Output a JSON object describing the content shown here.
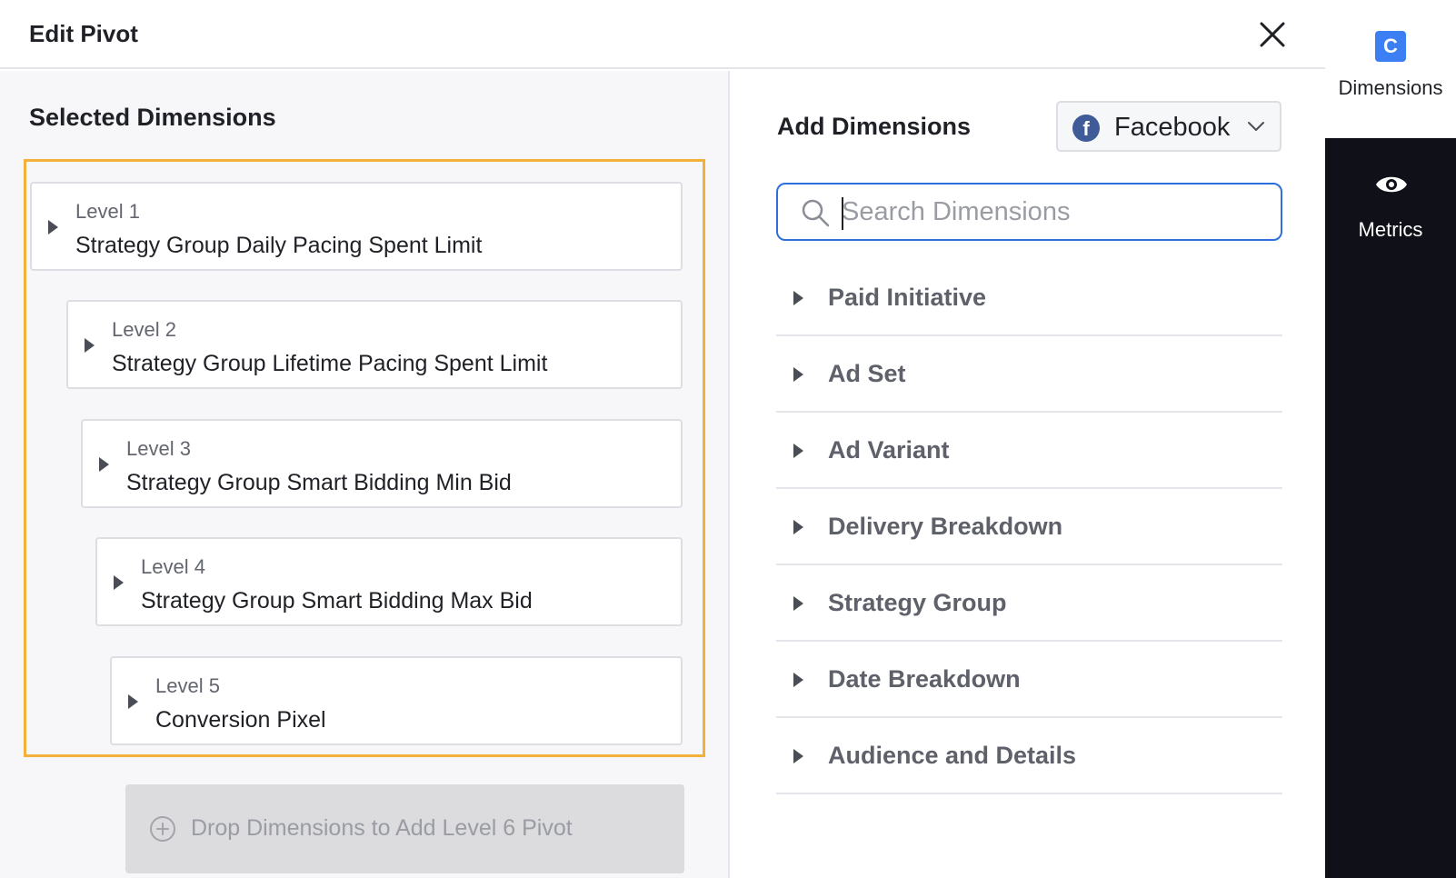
{
  "header": {
    "title": "Edit Pivot",
    "close_icon": "close-icon"
  },
  "selected": {
    "title": "Selected Dimensions",
    "levels": [
      {
        "level": "Level 1",
        "name": "Strategy Group Daily Pacing Spent Limit"
      },
      {
        "level": "Level 2",
        "name": "Strategy Group Lifetime Pacing Spent Limit"
      },
      {
        "level": "Level 3",
        "name": "Strategy Group Smart Bidding Min Bid"
      },
      {
        "level": "Level 4",
        "name": "Strategy Group Smart Bidding Max Bid"
      },
      {
        "level": "Level 5",
        "name": "Conversion Pixel"
      }
    ],
    "drop_target_label": "Drop Dimensions to Add Level 6 Pivot",
    "highlight_color": "#f3b13b"
  },
  "add": {
    "title": "Add Dimensions",
    "channel": {
      "label": "Facebook",
      "icon": "facebook-icon"
    },
    "search": {
      "placeholder": "Search Dimensions",
      "value": ""
    },
    "groups": [
      {
        "label": "Paid Initiative"
      },
      {
        "label": "Ad Set"
      },
      {
        "label": "Ad Variant"
      },
      {
        "label": "Delivery Breakdown"
      },
      {
        "label": "Strategy Group"
      },
      {
        "label": "Date Breakdown"
      },
      {
        "label": "Audience and Details"
      }
    ]
  },
  "rail": {
    "dimensions": {
      "label": "Dimensions",
      "icon_letter": "C"
    },
    "metrics": {
      "label": "Metrics",
      "icon": "eye-icon"
    }
  },
  "colors": {
    "accent": "#2f6fdc",
    "rail_bg": "#0f1018",
    "facebook": "#3f5b98"
  }
}
